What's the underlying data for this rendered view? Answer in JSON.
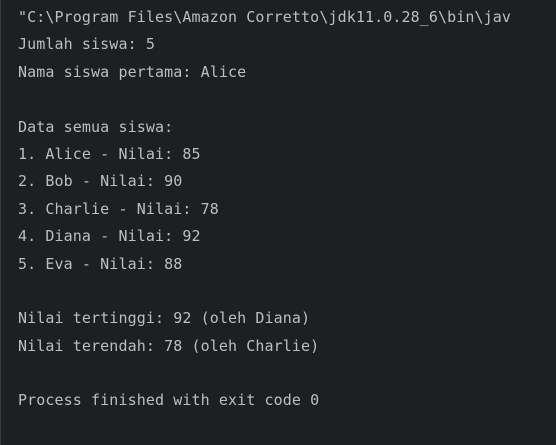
{
  "console": {
    "lines": [
      "\"C:\\Program Files\\Amazon Corretto\\jdk11.0.28_6\\bin\\jav",
      "Jumlah siswa: 5",
      "Nama siswa pertama: Alice",
      "",
      "Data semua siswa:",
      "1. Alice - Nilai: 85",
      "2. Bob - Nilai: 90",
      "3. Charlie - Nilai: 78",
      "4. Diana - Nilai: 92",
      "5. Eva - Nilai: 88",
      "",
      "Nilai tertinggi: 92 (oleh Diana)",
      "Nilai terendah: 78 (oleh Charlie)",
      "",
      "Process finished with exit code 0"
    ]
  },
  "colors": {
    "background": "#1e1f22",
    "text": "#bcbec4"
  }
}
